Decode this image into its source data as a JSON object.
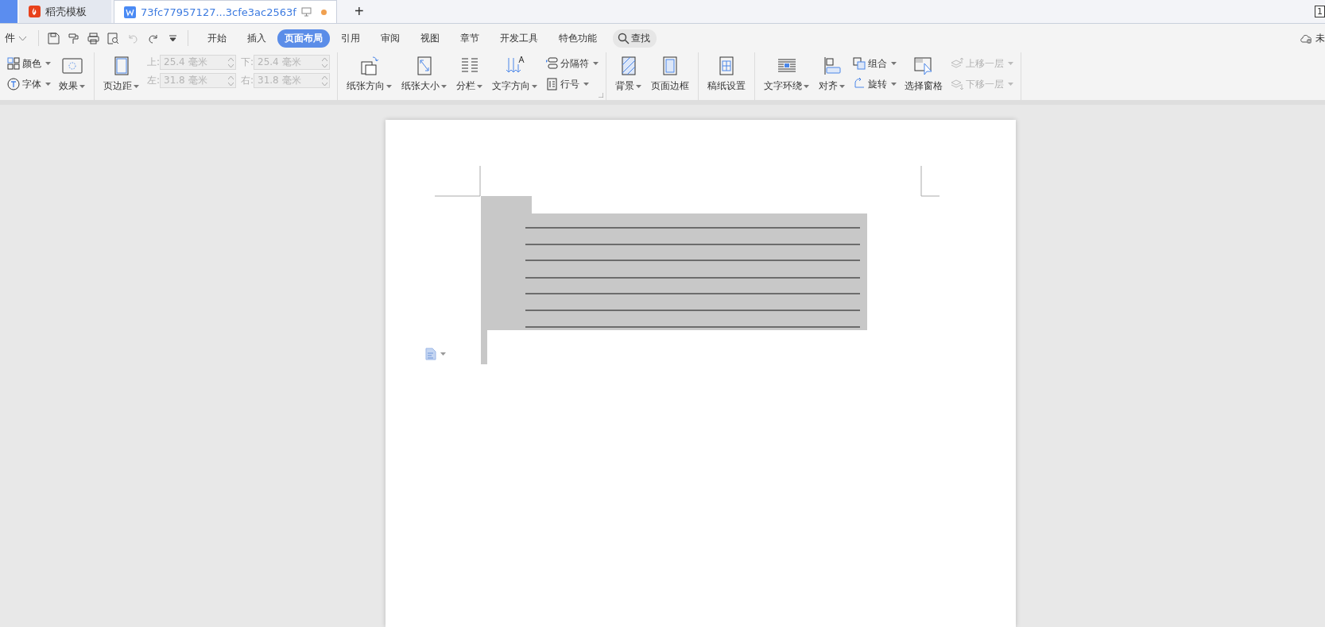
{
  "tabs": [
    {
      "label": "稻壳模板",
      "kind": "docer",
      "selected": false
    },
    {
      "label": "73fc77957127...3cfe3ac2563f",
      "kind": "writer",
      "selected": true,
      "modified": true
    }
  ],
  "new_tab": "+",
  "corner_badge": "1",
  "menu": {
    "file_label": "件",
    "quick_access": [
      {
        "disabled": false
      },
      {
        "disabled": false
      },
      {
        "disabled": false
      },
      {
        "disabled": false
      },
      {
        "disabled": true
      },
      {
        "disabled": false
      },
      {
        "disabled": false
      }
    ],
    "tabs": [
      {
        "label": "开始",
        "selected": false
      },
      {
        "label": "插入",
        "selected": false
      },
      {
        "label": "页面布局",
        "selected": true
      },
      {
        "label": "引用",
        "selected": false
      },
      {
        "label": "审阅",
        "selected": false
      },
      {
        "label": "视图",
        "selected": false
      },
      {
        "label": "章节",
        "selected": false
      },
      {
        "label": "开发工具",
        "selected": false
      },
      {
        "label": "特色功能",
        "selected": false
      }
    ],
    "search": "查找",
    "sync_status": "未"
  },
  "ribbon": {
    "groups": [
      {
        "items": [
          {
            "kind": "stack",
            "items": [
              {
                "label": "颜色",
                "dropdown": true,
                "disabled": false
              },
              {
                "label": "字体",
                "dropdown": true,
                "disabled": false
              }
            ]
          },
          {
            "kind": "large",
            "label": "效果",
            "dropdown": true,
            "disabled": false
          }
        ]
      },
      {
        "items": [
          {
            "kind": "large",
            "label": "页边距",
            "dropdown": true,
            "disabled": false
          },
          {
            "kind": "fields",
            "disabled": true,
            "items": [
              {
                "label": "上:",
                "value": "25.4 毫米"
              },
              {
                "label": "左:",
                "value": "31.8 毫米"
              },
              {
                "label": "下:",
                "value": "25.4 毫米"
              },
              {
                "label": "右:",
                "value": "31.8 毫米"
              }
            ]
          }
        ]
      },
      {
        "launcher": true,
        "items": [
          {
            "kind": "large",
            "label": "纸张方向",
            "dropdown": true,
            "disabled": false
          },
          {
            "kind": "large",
            "label": "纸张大小",
            "dropdown": true,
            "disabled": false
          },
          {
            "kind": "large",
            "label": "分栏",
            "dropdown": true,
            "disabled": false
          },
          {
            "kind": "large",
            "label": "文字方向",
            "dropdown": true,
            "disabled": false
          },
          {
            "kind": "stack",
            "items": [
              {
                "label": "分隔符",
                "dropdown": true,
                "disabled": false
              },
              {
                "label": "行号",
                "dropdown": true,
                "disabled": false
              }
            ]
          }
        ]
      },
      {
        "items": [
          {
            "kind": "large",
            "label": "背景",
            "dropdown": true,
            "disabled": false
          },
          {
            "kind": "large",
            "label": "页面边框",
            "dropdown": false,
            "disabled": false
          }
        ]
      },
      {
        "items": [
          {
            "kind": "large",
            "label": "稿纸设置",
            "dropdown": false,
            "disabled": false
          }
        ]
      },
      {
        "items": [
          {
            "kind": "large",
            "label": "文字环绕",
            "dropdown": true,
            "disabled": false
          },
          {
            "kind": "large",
            "label": "对齐",
            "dropdown": true,
            "disabled": false
          },
          {
            "kind": "stack",
            "items": [
              {
                "label": "组合",
                "dropdown": true,
                "disabled": false
              },
              {
                "label": "旋转",
                "dropdown": true,
                "disabled": false
              }
            ]
          },
          {
            "kind": "large",
            "label": "选择窗格",
            "dropdown": false,
            "disabled": false
          },
          {
            "kind": "stack",
            "items": [
              {
                "label": "上移一层",
                "dropdown": true,
                "disabled": true
              },
              {
                "label": "下移一层",
                "dropdown": true,
                "disabled": true
              }
            ]
          }
        ]
      }
    ]
  }
}
